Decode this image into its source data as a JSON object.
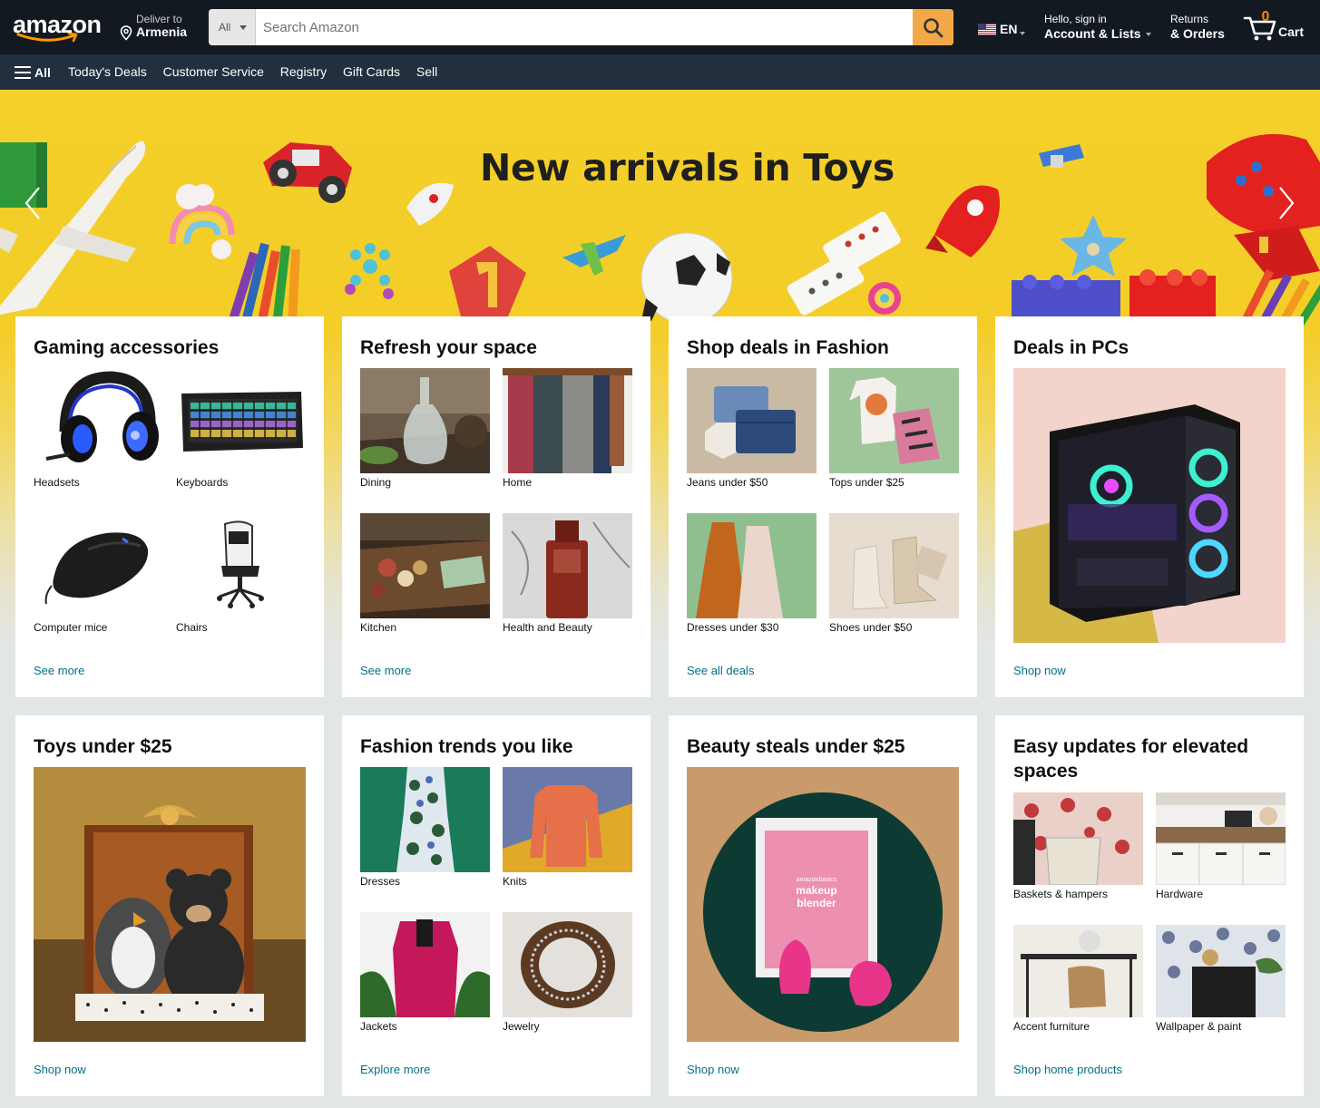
{
  "header": {
    "logo_text": "amazon",
    "deliver_line1": "Deliver to",
    "deliver_line2": "Armenia",
    "search": {
      "department": "All",
      "placeholder": "Search Amazon"
    },
    "language": "EN",
    "account_line1": "Hello, sign in",
    "account_line2": "Account & Lists",
    "orders_line1": "Returns",
    "orders_line2": "& Orders",
    "cart_count": "0",
    "cart_label": "Cart"
  },
  "subnav": {
    "all_label": "All",
    "links": [
      "Today's Deals",
      "Customer Service",
      "Registry",
      "Gift Cards",
      "Sell"
    ]
  },
  "hero": {
    "title": "New arrivals in Toys"
  },
  "cards": [
    {
      "title": "Gaming accessories",
      "items": [
        "Headsets",
        "Keyboards",
        "Computer mice",
        "Chairs"
      ],
      "footer": "See more"
    },
    {
      "title": "Refresh your space",
      "items": [
        "Dining",
        "Home",
        "Kitchen",
        "Health and Beauty"
      ],
      "footer": "See more"
    },
    {
      "title": "Shop deals in Fashion",
      "items": [
        "Jeans under $50",
        "Tops under $25",
        "Dresses under $30",
        "Shoes under $50"
      ],
      "footer": "See all deals"
    },
    {
      "title": "Deals in PCs",
      "footer": "Shop now"
    },
    {
      "title": "Toys under $25",
      "footer": "Shop now"
    },
    {
      "title": "Fashion trends you like",
      "items": [
        "Dresses",
        "Knits",
        "Jackets",
        "Jewelry"
      ],
      "footer": "Explore more"
    },
    {
      "title": "Beauty steals under $25",
      "image_text": [
        "amazonbasics",
        "makeup",
        "blender"
      ],
      "footer": "Shop now"
    },
    {
      "title": "Easy updates for elevated spaces",
      "items": [
        "Baskets & hampers",
        "Hardware",
        "Accent furniture",
        "Wallpaper & paint"
      ],
      "footer": "Shop home products"
    }
  ],
  "colors": {
    "nav_dark": "#131921",
    "nav_sub": "#232f3e",
    "search_button": "#f3a847",
    "link": "#007185",
    "hero_yellow": "#f5d02a",
    "cart_count": "#f08804"
  }
}
